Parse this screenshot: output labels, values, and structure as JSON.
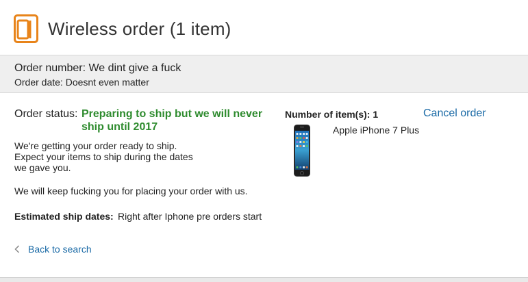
{
  "header": {
    "title": "Wireless order (1 item)",
    "icon": "devices-icon",
    "icon_color": "#e8841a"
  },
  "order": {
    "number": "Order number: We dint give a fuck",
    "date": "Order date: Doesnt even matter"
  },
  "status": {
    "label": "Order status:",
    "value": "Preparing to ship but we will never ship until 2017",
    "value_color": "#2e8b2e",
    "description_1": "We're getting your order ready to ship. Expect your items to ship during the dates we gave you.",
    "description_2": "We will keep fucking you for placing your order with us.",
    "ship_dates_label": "Estimated ship dates:",
    "ship_dates_value": "Right after Iphone pre orders start"
  },
  "items": {
    "count_label": "Number of item(s): 1",
    "cancel_label": "Cancel order",
    "list": [
      {
        "name": "Apple iPhone 7 Plus",
        "icon": "iphone-image"
      }
    ]
  },
  "nav": {
    "back_label": "Back to search",
    "back_icon": "chevron-left-icon"
  },
  "colors": {
    "link": "#1a6aa6",
    "band": "#efefef"
  }
}
